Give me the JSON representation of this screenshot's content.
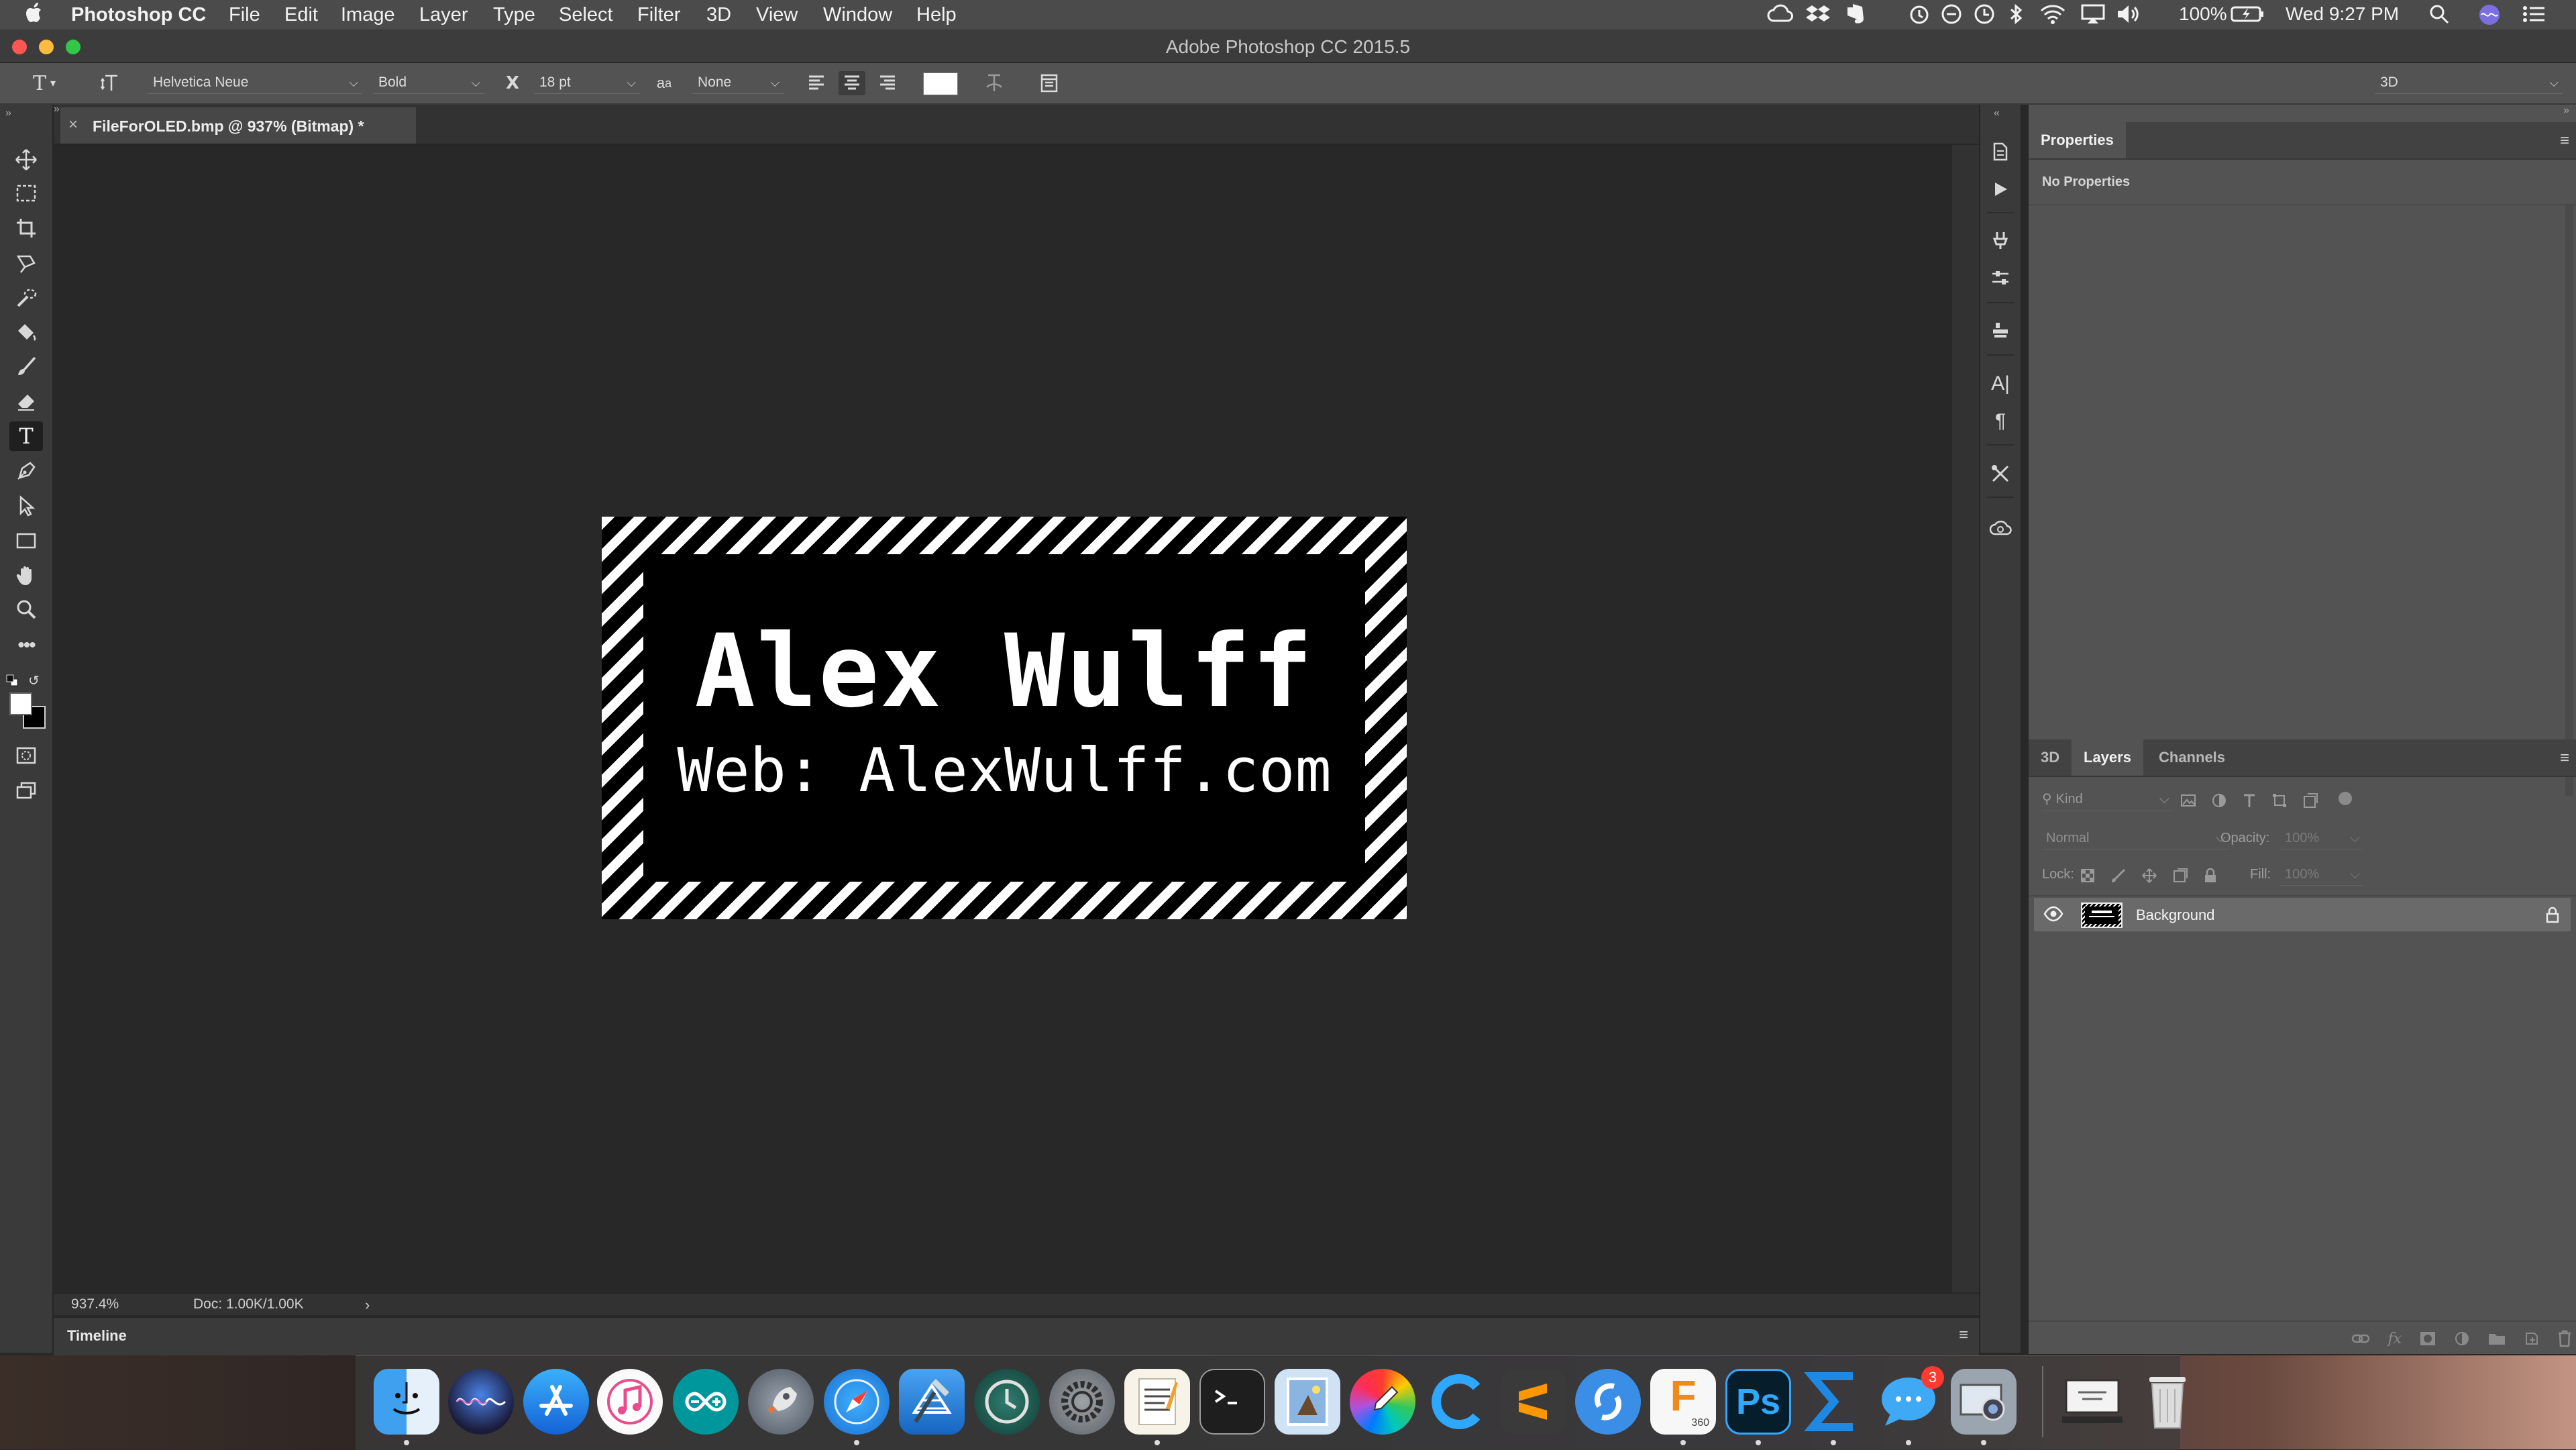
{
  "menubar": {
    "apple_icon": "apple-logo",
    "app_name": "Photoshop CC",
    "items": [
      "File",
      "Edit",
      "Image",
      "Layer",
      "Type",
      "Select",
      "Filter",
      "3D",
      "View",
      "Window",
      "Help"
    ],
    "battery": "100%",
    "clock": "Wed 9:27 PM"
  },
  "window": {
    "title": "Adobe Photoshop CC 2015.5"
  },
  "options_bar": {
    "font_family": "Helvetica Neue",
    "font_style": "Bold",
    "font_size": "18 pt",
    "antialias_symbol": "a",
    "antialias": "None",
    "workspace": "3D"
  },
  "document": {
    "tab_title": "FileForOLED.bmp @ 937% (Bitmap) *",
    "image_text_line1": "Alex Wulff",
    "image_text_line2": "Web: AlexWulff.com"
  },
  "status": {
    "zoom": "937.4%",
    "doc": "Doc: 1.00K/1.00K"
  },
  "timeline": {
    "title": "Timeline"
  },
  "properties": {
    "tab": "Properties",
    "content": "No Properties"
  },
  "layers_panel": {
    "tabs": [
      "3D",
      "Layers",
      "Channels"
    ],
    "active_tab": "Layers",
    "filter_kind": "Kind",
    "blend_mode": "Normal",
    "opacity_label": "Opacity:",
    "opacity_value": "100%",
    "lock_label": "Lock:",
    "fill_label": "Fill:",
    "fill_value": "100%",
    "layers": [
      {
        "name": "Background",
        "visible": true,
        "locked": true
      }
    ]
  },
  "dock": {
    "apps": [
      "finder",
      "siri",
      "app-store",
      "itunes",
      "arduino",
      "launchpad",
      "safari",
      "xcode",
      "time-machine",
      "system-preferences",
      "textedit",
      "terminal",
      "preview",
      "color-picker",
      "c-app",
      "sublime-text",
      "simplenote",
      "fusion-360",
      "photoshop",
      "sigma-app",
      "messages",
      "image-capture",
      "screenshot-preview",
      "trash"
    ],
    "messages_badge": "3",
    "fusion_label": "F",
    "fusion_sub": "360",
    "photoshop_label": "Ps"
  },
  "colors": {
    "accent": "#1473e6",
    "panel": "#535353",
    "canvas": "#282828",
    "dock_badge": "#ff3b30"
  }
}
